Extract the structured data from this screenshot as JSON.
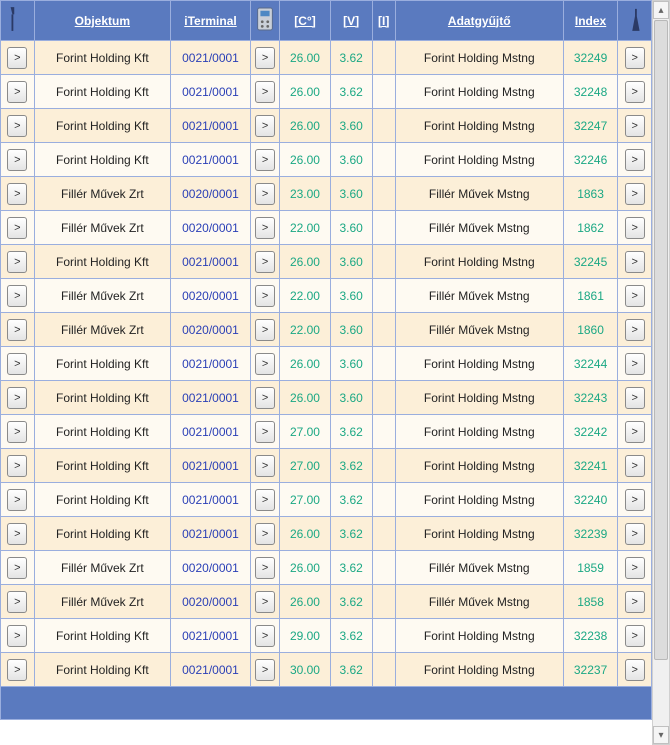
{
  "headers": {
    "obj": "Objektum",
    "iterm": "iTerminal",
    "c": "[C°]",
    "v": "[V]",
    "i": "[I]",
    "adat": "Adatgyűjtő",
    "index": "Index"
  },
  "go_label": ">",
  "rows": [
    {
      "obj": "Forint Holding Kft",
      "iterm": "0021/0001",
      "c": "26.00",
      "v": "3.62",
      "i": "",
      "adat": "Forint Holding Mstng",
      "index": "32249"
    },
    {
      "obj": "Forint Holding Kft",
      "iterm": "0021/0001",
      "c": "26.00",
      "v": "3.62",
      "i": "",
      "adat": "Forint Holding Mstng",
      "index": "32248"
    },
    {
      "obj": "Forint Holding Kft",
      "iterm": "0021/0001",
      "c": "26.00",
      "v": "3.60",
      "i": "",
      "adat": "Forint Holding Mstng",
      "index": "32247"
    },
    {
      "obj": "Forint Holding Kft",
      "iterm": "0021/0001",
      "c": "26.00",
      "v": "3.60",
      "i": "",
      "adat": "Forint Holding Mstng",
      "index": "32246"
    },
    {
      "obj": "Fillér Művek Zrt",
      "iterm": "0020/0001",
      "c": "23.00",
      "v": "3.60",
      "i": "",
      "adat": "Fillér Művek Mstng",
      "index": "1863"
    },
    {
      "obj": "Fillér Művek Zrt",
      "iterm": "0020/0001",
      "c": "22.00",
      "v": "3.60",
      "i": "",
      "adat": "Fillér Művek Mstng",
      "index": "1862"
    },
    {
      "obj": "Forint Holding Kft",
      "iterm": "0021/0001",
      "c": "26.00",
      "v": "3.60",
      "i": "",
      "adat": "Forint Holding Mstng",
      "index": "32245"
    },
    {
      "obj": "Fillér Művek Zrt",
      "iterm": "0020/0001",
      "c": "22.00",
      "v": "3.60",
      "i": "",
      "adat": "Fillér Művek Mstng",
      "index": "1861"
    },
    {
      "obj": "Fillér Művek Zrt",
      "iterm": "0020/0001",
      "c": "22.00",
      "v": "3.60",
      "i": "",
      "adat": "Fillér Művek Mstng",
      "index": "1860"
    },
    {
      "obj": "Forint Holding Kft",
      "iterm": "0021/0001",
      "c": "26.00",
      "v": "3.60",
      "i": "",
      "adat": "Forint Holding Mstng",
      "index": "32244"
    },
    {
      "obj": "Forint Holding Kft",
      "iterm": "0021/0001",
      "c": "26.00",
      "v": "3.60",
      "i": "",
      "adat": "Forint Holding Mstng",
      "index": "32243"
    },
    {
      "obj": "Forint Holding Kft",
      "iterm": "0021/0001",
      "c": "27.00",
      "v": "3.62",
      "i": "",
      "adat": "Forint Holding Mstng",
      "index": "32242"
    },
    {
      "obj": "Forint Holding Kft",
      "iterm": "0021/0001",
      "c": "27.00",
      "v": "3.62",
      "i": "",
      "adat": "Forint Holding Mstng",
      "index": "32241"
    },
    {
      "obj": "Forint Holding Kft",
      "iterm": "0021/0001",
      "c": "27.00",
      "v": "3.62",
      "i": "",
      "adat": "Forint Holding Mstng",
      "index": "32240"
    },
    {
      "obj": "Forint Holding Kft",
      "iterm": "0021/0001",
      "c": "26.00",
      "v": "3.62",
      "i": "",
      "adat": "Forint Holding Mstng",
      "index": "32239"
    },
    {
      "obj": "Fillér Művek Zrt",
      "iterm": "0020/0001",
      "c": "26.00",
      "v": "3.62",
      "i": "",
      "adat": "Fillér Művek Mstng",
      "index": "1859"
    },
    {
      "obj": "Fillér Művek Zrt",
      "iterm": "0020/0001",
      "c": "26.00",
      "v": "3.62",
      "i": "",
      "adat": "Fillér Művek Mstng",
      "index": "1858"
    },
    {
      "obj": "Forint Holding Kft",
      "iterm": "0021/0001",
      "c": "29.00",
      "v": "3.62",
      "i": "",
      "adat": "Forint Holding Mstng",
      "index": "32238"
    },
    {
      "obj": "Forint Holding Kft",
      "iterm": "0021/0001",
      "c": "30.00",
      "v": "3.62",
      "i": "",
      "adat": "Forint Holding Mstng",
      "index": "32237"
    }
  ]
}
